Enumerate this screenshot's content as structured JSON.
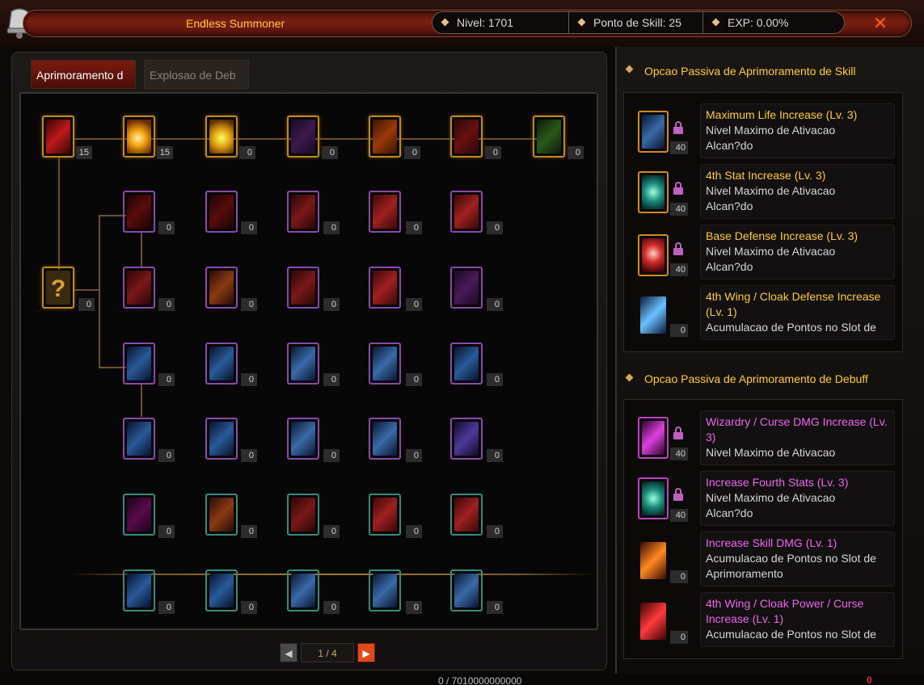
{
  "window": {
    "title": "Endless Summoner",
    "nivel": "Nivel: 1701",
    "ponto_skill": "Ponto de Skill: 25",
    "exp": "EXP:  0.00%",
    "close": "✕"
  },
  "tabs": [
    {
      "label": "Aprimoramento d",
      "active": true
    },
    {
      "label": "Explosao de Deb",
      "active": false
    }
  ],
  "grid": {
    "rows": [
      [
        {
          "c": "15"
        },
        {
          "c": "15"
        },
        {
          "c": "0"
        },
        {
          "c": "0"
        },
        {
          "c": "0"
        },
        {
          "c": "0"
        },
        {
          "c": "0"
        }
      ],
      [
        {
          "c": "0"
        },
        {
          "c": "0"
        },
        {
          "c": "0"
        },
        {
          "c": "0"
        },
        {
          "c": "0"
        }
      ],
      [
        {
          "c": "0"
        },
        {
          "c": "0"
        },
        {
          "c": "0"
        },
        {
          "c": "0"
        },
        {
          "c": "0"
        },
        {
          "c": "0"
        }
      ],
      [
        {
          "c": "0"
        },
        {
          "c": "0"
        },
        {
          "c": "0"
        },
        {
          "c": "0"
        },
        {
          "c": "0"
        }
      ],
      [
        {
          "c": "0"
        },
        {
          "c": "0"
        },
        {
          "c": "0"
        },
        {
          "c": "0"
        },
        {
          "c": "0"
        }
      ],
      [
        {
          "c": "0"
        },
        {
          "c": "0"
        },
        {
          "c": "0"
        },
        {
          "c": "0"
        },
        {
          "c": "0"
        }
      ],
      [
        {
          "c": "0"
        },
        {
          "c": "0"
        },
        {
          "c": "0"
        },
        {
          "c": "0"
        },
        {
          "c": "0"
        }
      ]
    ],
    "question_mark": "?"
  },
  "pager": {
    "prev": "◀",
    "page": "1 / 4",
    "next": "▶"
  },
  "sections": [
    {
      "header": "Opcao Passiva de Aprimoramento de Skill",
      "entries": [
        {
          "title": "Maximum Life Increase (Lv. 3)",
          "line1": "Nivel Maximo de Ativacao",
          "line2": "Alcan?do",
          "count": "40",
          "locked": true
        },
        {
          "title": "4th Stat Increase (Lv. 3)",
          "line1": "Nivel Maximo de Ativacao",
          "line2": "Alcan?do",
          "count": "40",
          "locked": true
        },
        {
          "title": "Base Defense Increase (Lv. 3)",
          "line1": "Nivel Maximo de Ativacao",
          "line2": "Alcan?do",
          "count": "40",
          "locked": true
        },
        {
          "title": "4th Wing / Cloak Defense Increase (Lv. 1)",
          "line1": "Acumulacao de Pontos no Slot de",
          "line2": "",
          "count": "0",
          "locked": false
        }
      ]
    },
    {
      "header": "Opcao Passiva de Aprimoramento de Debuff",
      "entries": [
        {
          "title": "Wizardry / Curse DMG Increase (Lv. 3)",
          "line1": "Nivel Maximo de Ativacao",
          "line2": "",
          "count": "40",
          "locked": true
        },
        {
          "title": "Increase Fourth Stats (Lv. 3)",
          "line1": "Nivel Maximo de Ativacao",
          "line2": "Alcan?do",
          "count": "40",
          "locked": true
        },
        {
          "title": "Increase Skill DMG (Lv. 1)",
          "line1": "Acumulacao de Pontos no Slot de",
          "line2": "Aprimoramento",
          "count": "0",
          "locked": false
        },
        {
          "title": "4th Wing / Cloak Power / Curse Increase (Lv. 1)",
          "line1": "Acumulacao de Pontos no Slot de",
          "line2": "",
          "count": "0",
          "locked": false
        }
      ]
    }
  ],
  "bottom": {
    "value": "0  /  7010000000000",
    "right": "0"
  }
}
